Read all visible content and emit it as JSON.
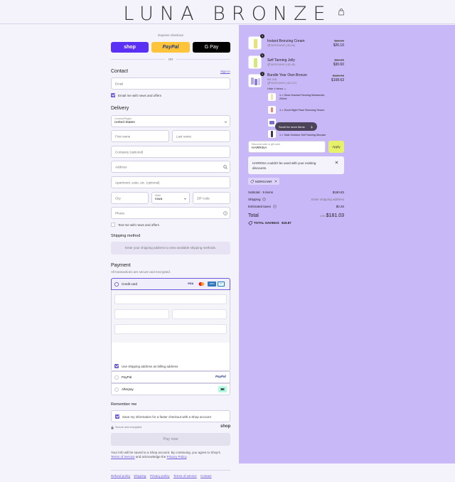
{
  "header": {
    "brand": "LUNA BRONZE"
  },
  "express": {
    "label": "Express checkout",
    "shop_label": "shop",
    "paypal_label": "PayPal",
    "gpay_label": "G Pay",
    "or_label": "OR"
  },
  "contact": {
    "title": "Contact",
    "sign_in": "Sign in",
    "email_placeholder": "Email",
    "news_label": "Email me with news and offers"
  },
  "delivery": {
    "title": "Delivery",
    "country_label": "Country/Region",
    "country_value": "United States",
    "first_name": "First name",
    "last_name": "Last name",
    "company": "Company (optional)",
    "address": "Address",
    "apartment": "Apartment, suite, etc. (optional)",
    "city": "City",
    "state_label": "State",
    "state_value": "Iowa",
    "zip": "ZIP code",
    "phone": "Phone",
    "text_label": "Text me with news and offers"
  },
  "shipping": {
    "title": "Shipping method",
    "message": "Enter your shipping address to view available shipping methods."
  },
  "payment": {
    "title": "Payment",
    "subtitle": "All transactions are secure and encrypted.",
    "credit_card": "Credit card",
    "card_brands": [
      "VISA",
      "MC",
      "AMEX",
      "DC"
    ],
    "billing_label": "Use shipping address as billing address",
    "paypal": "PayPal",
    "paypal_logo": "PayPal",
    "afterpay": "Afterpay"
  },
  "remember": {
    "title": "Remember me",
    "save_label": "Save my information for a faster checkout with a Shop account",
    "secure": "Secure and encrypted",
    "shop_logo": "shop"
  },
  "pay_button": "Pay now",
  "legal": {
    "line1": "Your info will be saved to a Shop account. By continuing, you agree to Shop's",
    "terms": "Terms of Service",
    "and_ack": " and acknowledge the ",
    "privacy": "Privacy Policy",
    "period": "."
  },
  "footer_links": [
    "Refund policy",
    "Shipping",
    "Privacy policy",
    "Terms of service",
    "Contact"
  ],
  "items": [
    {
      "qty": "1",
      "name": "Instant Bronzing Cream",
      "discount": "MORGANR (-$3.60)",
      "old_price": "$29.00",
      "price": "$26.10"
    },
    {
      "qty": "1",
      "name": "Self Tanning Jelly",
      "discount": "MORGANR (-$3.40)",
      "old_price": "$34.00",
      "price": "$30.60"
    },
    {
      "qty": "1",
      "name": "Bundle Your Own Bronze",
      "variant": "BR-408",
      "discount": "MORGANR (-$12.07)",
      "old_price": "$120.70",
      "price": "$108.63",
      "hide_label": "Hide 4 items"
    }
  ],
  "sub_items": [
    "1 × Glow Graduel Tanning Moisturizer, 200ml",
    "1 × Good Night Face Bronzing Serum",
    "1 × Total Outdoor Self Tanning Mousse"
  ],
  "scroll_label": "Scroll for more items",
  "discount": {
    "field_label": "Discount code or gift card",
    "field_value": "HARRISA",
    "apply": "Apply",
    "error": "HARRISA couldn't be used with your existing discounts.",
    "tag": "MORGANR"
  },
  "totals": {
    "subtotal_label": "Subtotal · 5 items",
    "subtotal_value": "$180.83",
    "shipping_label": "Shipping",
    "shipping_value": "Enter shipping address",
    "taxes_label": "Estimated taxes",
    "taxes_value": "$0.20",
    "total_label": "Total",
    "currency": "USD",
    "total_value": "$181.03",
    "savings_label": "TOTAL SAVINGS",
    "savings_value": "$19.87"
  },
  "colors": {
    "accent": "#6b5bd6",
    "summary_bg": "#c9b8f7",
    "shop_blue": "#5a31f4",
    "paypal_yellow": "#ffc439",
    "apply_bg": "#e7f26a"
  }
}
